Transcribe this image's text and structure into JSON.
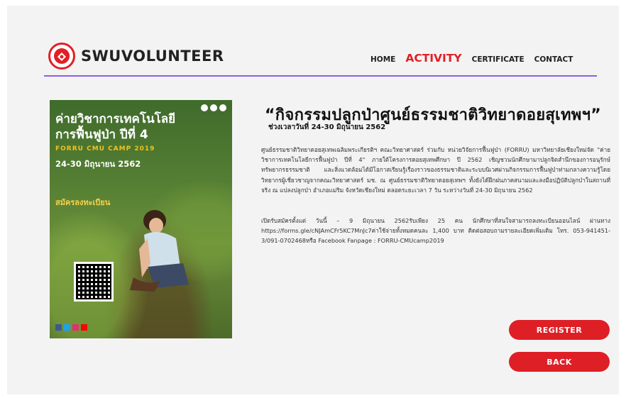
{
  "header": {
    "brand": "SWUVOLUNTEER",
    "nav": [
      {
        "label": "HOME"
      },
      {
        "label": "ACTIVITY"
      },
      {
        "label": "CERTIFICATE"
      },
      {
        "label": "CONTACT"
      }
    ],
    "active_nav": "ACTIVITY",
    "divider_color": "#8a5fe8"
  },
  "poster": {
    "title": "ค่ายวิชาการเทคโนโลยี\nการฟื้นฟูป่า ปีที่ 4",
    "subtitle": "FORRU CMU CAMP 2019",
    "date": "24-30 มิถุนายน 2562",
    "register_text": "สมัครลงทะเบียน"
  },
  "article": {
    "title": "“กิจกรรมปลูกป่าศูนย์ธรรมชาติวิทยาดอยสุเทพฯ”",
    "subtitle": "ช่วงเวลาวันที่ 24-30 มิถุนายน 2562",
    "paragraph1": "ศูนย์ธรรมชาติวิทยาดอยสุเทพเฉลิมพระเกียรติฯ คณะวิทยาศาสตร์ ร่วมกับ หน่วยวิจัยการฟื้นฟูป่า (FORRU) มหาวิทยาลัยเชียงใหม่จัด \"ค่ายวิชาการเทคโนโลยีการฟื้นฟูป่า ปีที่ 4\" ภายใต้โครงการดอยสุเทพศึกษา ปี 2562 เชิญชวนนักศึกษามาปลูกจิตสำนึกของการอนุรักษ์ทรัพยากรธรรมชาติ และสิ่งแวดล้อมได้มีโอกาสเรียนรู้เรื่องราวของธรรมชาติและระบบนิเวศผ่านกิจกรรมการฟื้นฟูป่าท่ามกลางความรู้โดยวิทยากรผู้เชี่ยวชาญจากคณะวิทยาศาสตร์ มช. ณ ศูนย์ธรรมชาติวิทยาดอยสุเทพฯ ทั้งยังได้ฝึกฝนภาคสนามและลงมือปฏิบัติปลูกป่าในสถานที่จริง ณ แปลงปลูกป่า อำเภอแม่ริม จังหวัดเชียงใหม่ ตลอดระยะเวลา 7 วัน ระหว่างวันที่ 24-30 มิถุนายน 2562",
    "paragraph2": "เปิดรับสมัครตั้งแต่ วันนี้ – 9 มิถุนายน 2562รับเพียง 25 คน นักศึกษาที่สนใจสามารถลงทะเบียนออนไลน์ ผ่านทาง https://forms.gle/cNJAmCFr5KC7MnJc7ค่าใช้จ่ายทั้งหมดคนละ 1,400 บาท ติดต่อสอบถามรายละเอียดเพิ่มเติม โทร. 053-941451-3/091-0702468หรือ Facebook Fanpage : FORRU-CMUcamp2019"
  },
  "buttons": {
    "register": "REGISTER",
    "back": "BACK"
  },
  "colors": {
    "accent": "#e21f26",
    "background": "#f4f3f3"
  }
}
